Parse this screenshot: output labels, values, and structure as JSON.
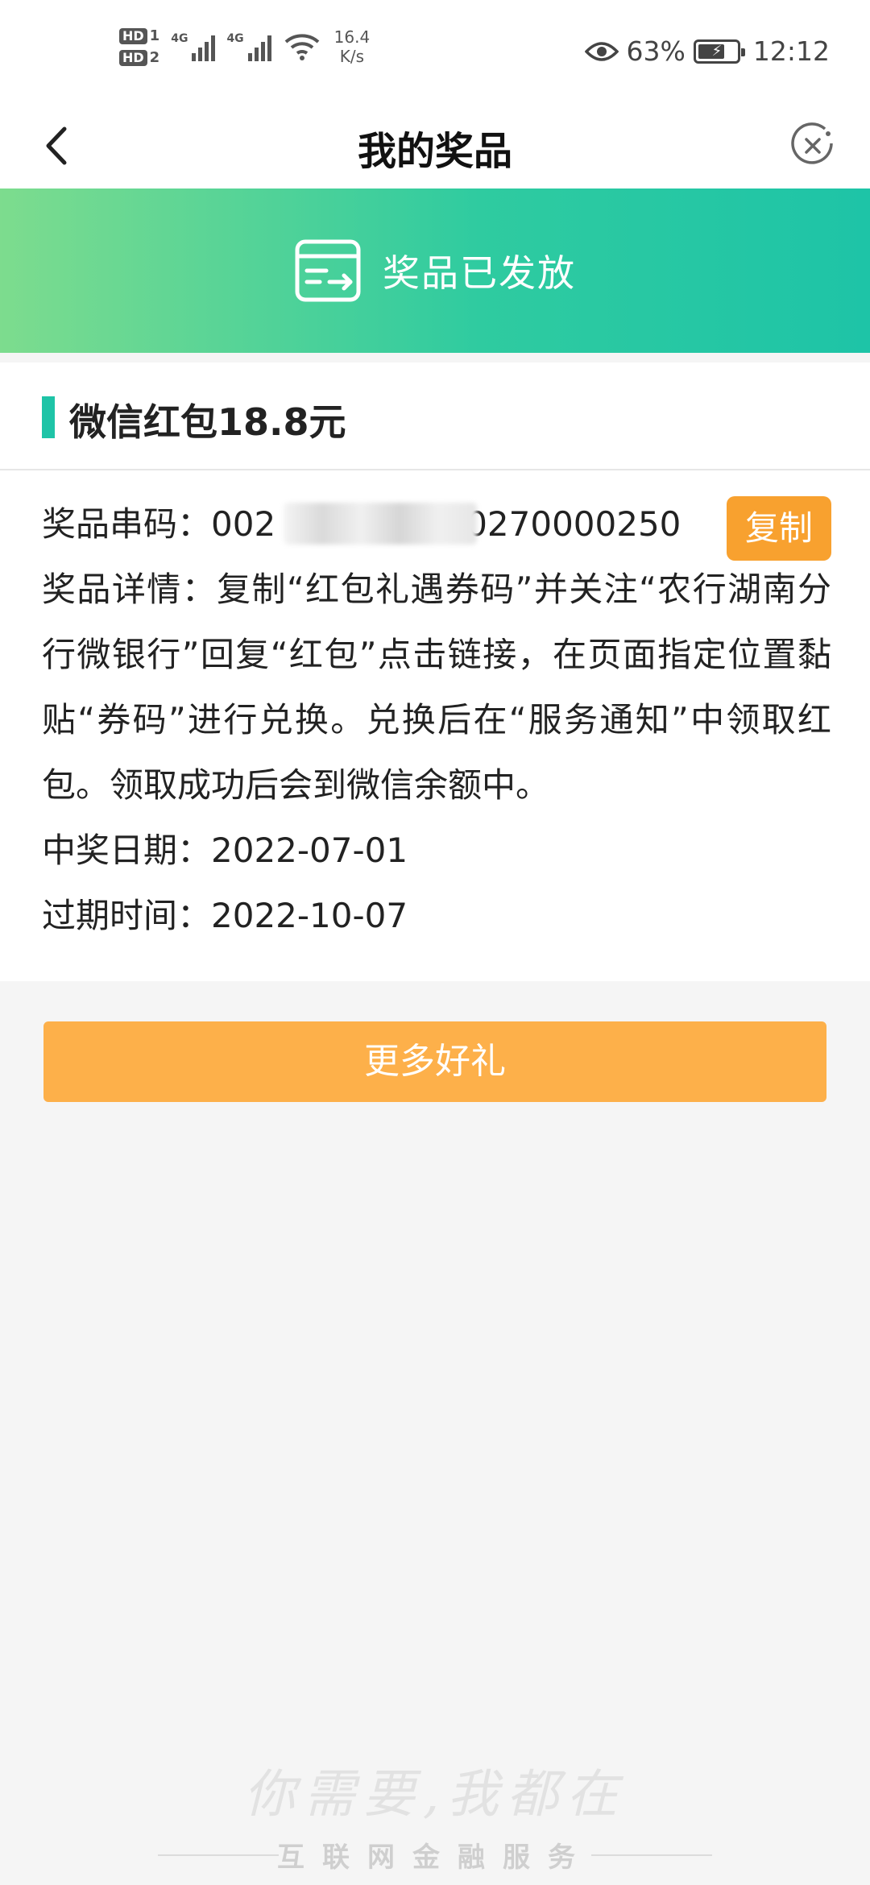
{
  "status_bar": {
    "hd1": "HD",
    "hd1_num": "1",
    "hd2": "HD",
    "hd2_num": "2",
    "sig1_label": "4G",
    "sig2_label": "4G",
    "speed_value": "16.4",
    "speed_unit": "K/s",
    "battery_percent": "63%",
    "time": "12:12"
  },
  "nav": {
    "title": "我的奖品"
  },
  "banner": {
    "status_text": "奖品已发放"
  },
  "prize": {
    "title": "微信红包18.8元",
    "code_label": "奖品串码：",
    "code_prefix": "002",
    "code_suffix": "0270000250",
    "copy_label": "复制",
    "details_label": "奖品详情：",
    "details_text": "复制“红包礼遇券码”并关注“农行湖南分行微银行”回复“红包”点击链接，在页面指定位置黏贴“券码”进行兑换。兑换后在“服务通知”中领取红包。领取成功后会到微信余额中。",
    "win_date_label": "中奖日期：",
    "win_date": "2022-07-01",
    "expire_label": "过期时间：",
    "expire_date": "2022-10-07"
  },
  "actions": {
    "more_label": "更多好礼"
  },
  "footer": {
    "slogan": "你需要,我都在",
    "service_text": "互联网金融服务"
  },
  "colors": {
    "accent": "#1ec4a7",
    "orange": "#f8a12f",
    "button": "#fdb04a"
  }
}
